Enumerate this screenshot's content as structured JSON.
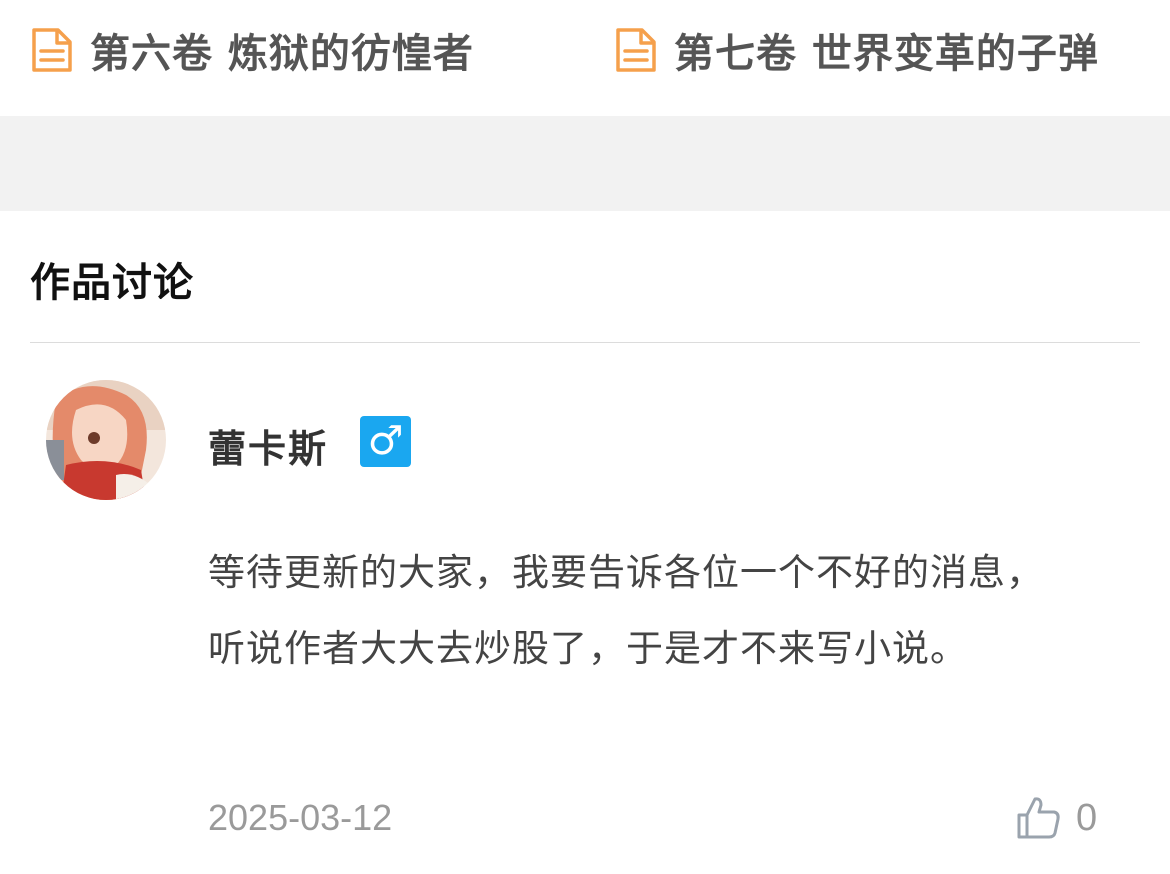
{
  "volumes": [
    {
      "title": "第六卷 炼狱的彷惶者",
      "icon": "document-icon"
    },
    {
      "title": "第七卷 世界变革的子弹",
      "icon": "document-icon"
    }
  ],
  "section": {
    "title": "作品讨论"
  },
  "comment": {
    "username": "蕾卡斯",
    "gender_symbol": "♂",
    "text": "等待更新的大家，我要告诉各位一个不好的消息，听说作者大大去炒股了，于是才不来写小说。",
    "date": "2025-03-12",
    "like_count": "0",
    "like_icon": "thumbs-up-icon"
  },
  "colors": {
    "accent_orange": "#f5a04c",
    "gender_badge": "#1aa7f0",
    "band_gray": "#f2f2f2",
    "meta_gray": "#9a9a9a"
  }
}
